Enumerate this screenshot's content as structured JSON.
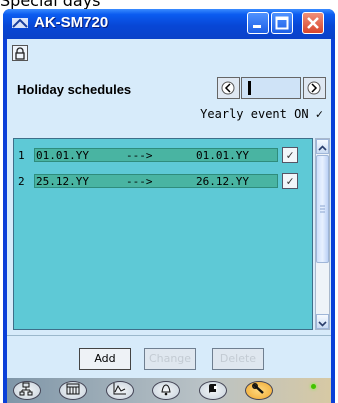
{
  "window": {
    "caption_partial": "Special days",
    "title": "AK-SM720"
  },
  "header": {
    "title": "Holiday schedules",
    "status_text": "Yearly event ON ✓"
  },
  "pager": {
    "current": ""
  },
  "schedules": [
    {
      "num": "1",
      "start": "01.01.YY",
      "arrow": "--->",
      "end": "01.01.YY",
      "checked": "✓"
    },
    {
      "num": "2",
      "start": "25.12.YY",
      "arrow": "--->",
      "end": "26.12.YY",
      "checked": "✓"
    }
  ],
  "actions": {
    "add": "Add",
    "change": "Change",
    "delete": "Delete"
  },
  "toolbar": [
    {
      "icon": "network-icon"
    },
    {
      "icon": "calendar-icon"
    },
    {
      "icon": "graph-icon"
    },
    {
      "icon": "bell-icon"
    },
    {
      "icon": "manual-icon"
    },
    {
      "icon": "wrench-icon"
    }
  ],
  "colors": {
    "titlebar": "#0b5cf0",
    "client_bg": "#d7ebfa",
    "list_bg": "#5ec9d6",
    "row_band": "#49b4a2",
    "led": "#43c200"
  }
}
